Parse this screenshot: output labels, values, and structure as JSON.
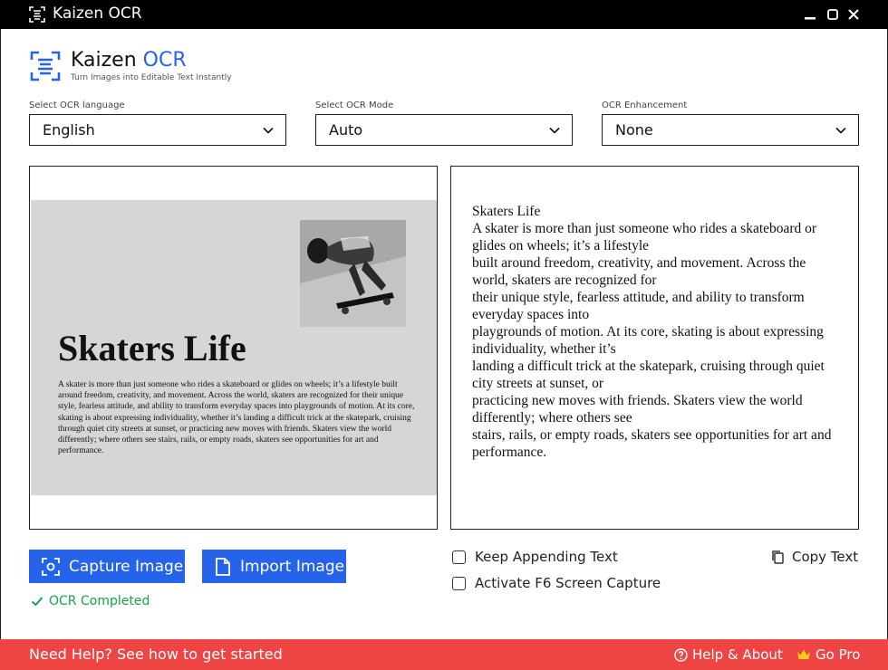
{
  "window": {
    "title": "Kaizen OCR"
  },
  "brand": {
    "name_main": "Kaizen",
    "name_accent": "OCR",
    "tagline": "Turn Images into Editable Text Instantly",
    "accent_color": "#2563eb"
  },
  "selects": {
    "language": {
      "label": "Select OCR language",
      "value": "English"
    },
    "mode": {
      "label": "Select OCR Mode",
      "value": "Auto"
    },
    "enhancement": {
      "label": "OCR Enhancement",
      "value": "None"
    }
  },
  "preview": {
    "title": "Skaters Life",
    "body": "A skater is more than just someone who rides a skateboard or glides on wheels; it’s a lifestyle built around freedom, creativity, and movement. Across the world, skaters are recognized for their unique style, fearless attitude, and ability to transform everyday spaces into playgrounds of motion. At its core, skating is about expressing individuality, whether it’s landing a difficult trick at the skatepark, cruising through quiet city streets at sunset, or practicing new moves with friends. Skaters view the world differently; where others see stairs, rails, or empty roads, skaters see opportunities for art and performance."
  },
  "ocr_output": {
    "text": "Skaters Life\nA skater is more than just someone who rides a skateboard or glides on wheels; it’s a lifestyle\nbuilt around freedom, creativity, and movement. Across the world, skaters are recognized for\ntheir unique style, fearless attitude, and ability to transform everyday spaces into\nplaygrounds of motion. At its core, skating is about expressing individuality, whether it’s\nlanding a difficult trick at the skatepark, cruising through quiet city streets at sunset, or\npracticing new moves with friends. Skaters view the world differently; where others see\nstairs, rails, or empty roads, skaters see opportunities for art and performance."
  },
  "buttons": {
    "capture": "Capture Image",
    "import": "Import Image"
  },
  "status": {
    "text": "OCR Completed",
    "color": "#16a34a"
  },
  "options": {
    "append": "Keep Appending Text",
    "f6": "Activate F6 Screen Capture",
    "copy": "Copy Text"
  },
  "footer": {
    "help": "Need Help? See how to get started",
    "about": "Help & About",
    "gopro": "Go Pro",
    "color": "#ef4444"
  },
  "icons": [
    "ocr-logo-icon",
    "minimize-icon",
    "maximize-icon",
    "close-icon",
    "chevron-down-icon",
    "camera-icon",
    "document-icon",
    "check-icon",
    "copy-icon",
    "help-icon",
    "crown-icon"
  ]
}
